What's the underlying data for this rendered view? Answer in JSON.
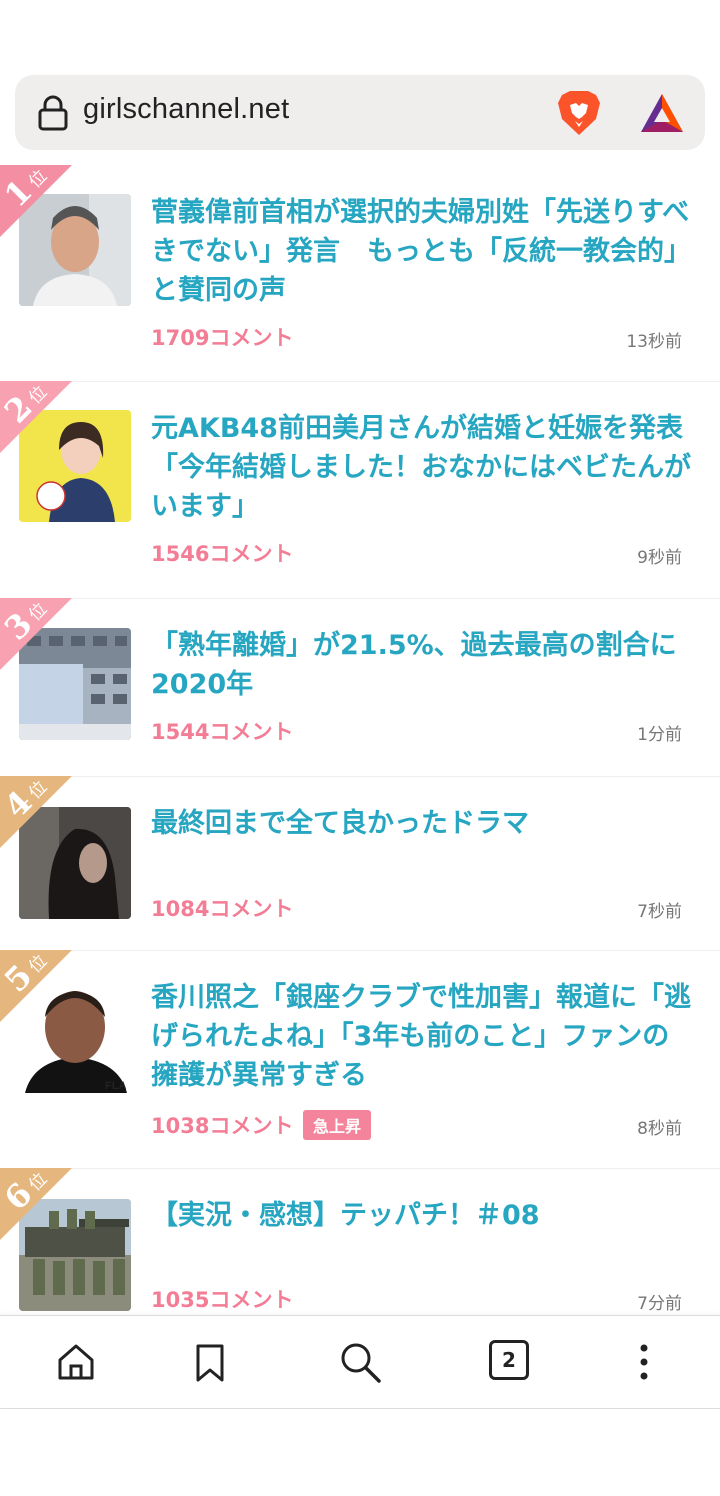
{
  "browser": {
    "url": "girlschannel.net",
    "open_tabs": "2"
  },
  "colors": {
    "title": "#27a6c2",
    "comments": "#f27d95",
    "rank_pink": "#f8a1b0",
    "rank_gold": "#e5b77e"
  },
  "items": [
    {
      "rank": "1",
      "rank_suffix": "位",
      "title": "菅義偉前首相が選択的夫婦別姓「先送りすべきでない」発言　もっとも「反統一教会的」と賛同の声",
      "comments": "1709コメント",
      "time": "13秒前",
      "badge": ""
    },
    {
      "rank": "2",
      "rank_suffix": "位",
      "title": "元AKB48前田美月さんが結婚と妊娠を発表「今年結婚しました！おなかにはベビたんがいます」",
      "comments": "1546コメント",
      "time": "9秒前",
      "badge": ""
    },
    {
      "rank": "3",
      "rank_suffix": "位",
      "title": "「熟年離婚」が21.5%、過去最高の割合に　2020年",
      "comments": "1544コメント",
      "time": "1分前",
      "badge": ""
    },
    {
      "rank": "4",
      "rank_suffix": "位",
      "title": "最終回まで全て良かったドラマ",
      "comments": "1084コメント",
      "time": "7秒前",
      "badge": ""
    },
    {
      "rank": "5",
      "rank_suffix": "位",
      "title": "香川照之「銀座クラブで性加害」報道に「逃げられたよね」「3年も前のこと」ファンの擁護が異常すぎる",
      "comments": "1038コメント",
      "time": "8秒前",
      "badge": "急上昇"
    },
    {
      "rank": "6",
      "rank_suffix": "位",
      "title": "【実況・感想】テッパチ！＃08",
      "comments": "1035コメント",
      "time": "7分前",
      "badge": ""
    }
  ]
}
